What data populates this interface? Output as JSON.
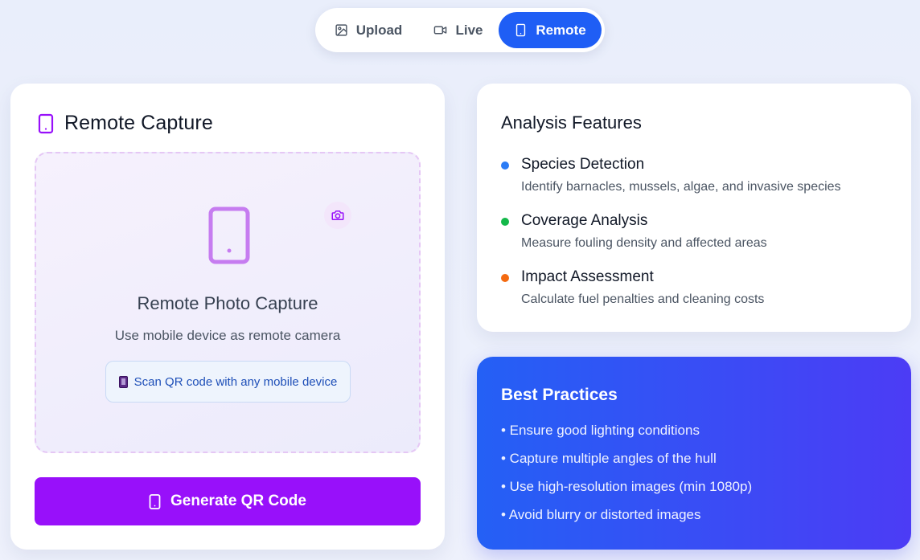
{
  "modes": {
    "upload": {
      "label": "Upload",
      "icon": "image-icon"
    },
    "live": {
      "label": "Live",
      "icon": "video-icon"
    },
    "remote": {
      "label": "Remote",
      "icon": "smartphone-icon",
      "active": true
    }
  },
  "remote_capture": {
    "title": "Remote Capture",
    "drop_zone": {
      "title": "Remote Photo Capture",
      "subtitle": "Use mobile device as remote camera",
      "hint": "Scan QR code with any mobile device"
    },
    "generate_button": "Generate QR Code"
  },
  "features": {
    "title": "Analysis Features",
    "items": [
      {
        "name": "Species Detection",
        "desc": "Identify barnacles, mussels, algae, and invasive species",
        "color": "#2b7cf6"
      },
      {
        "name": "Coverage Analysis",
        "desc": "Measure fouling density and affected areas",
        "color": "#14b84a"
      },
      {
        "name": "Impact Assessment",
        "desc": "Calculate fuel penalties and cleaning costs",
        "color": "#f46a10"
      }
    ]
  },
  "best_practices": {
    "title": "Best Practices",
    "items": [
      "• Ensure good lighting conditions",
      "• Capture multiple angles of the hull",
      "• Use high-resolution images (min 1080p)",
      "• Avoid blurry or distorted images"
    ]
  },
  "colors": {
    "primary_blue": "#1f5ef5",
    "purple": "#9810fa",
    "practices_gradient_start": "#2460f5",
    "practices_gradient_end": "#4c3cf5"
  }
}
